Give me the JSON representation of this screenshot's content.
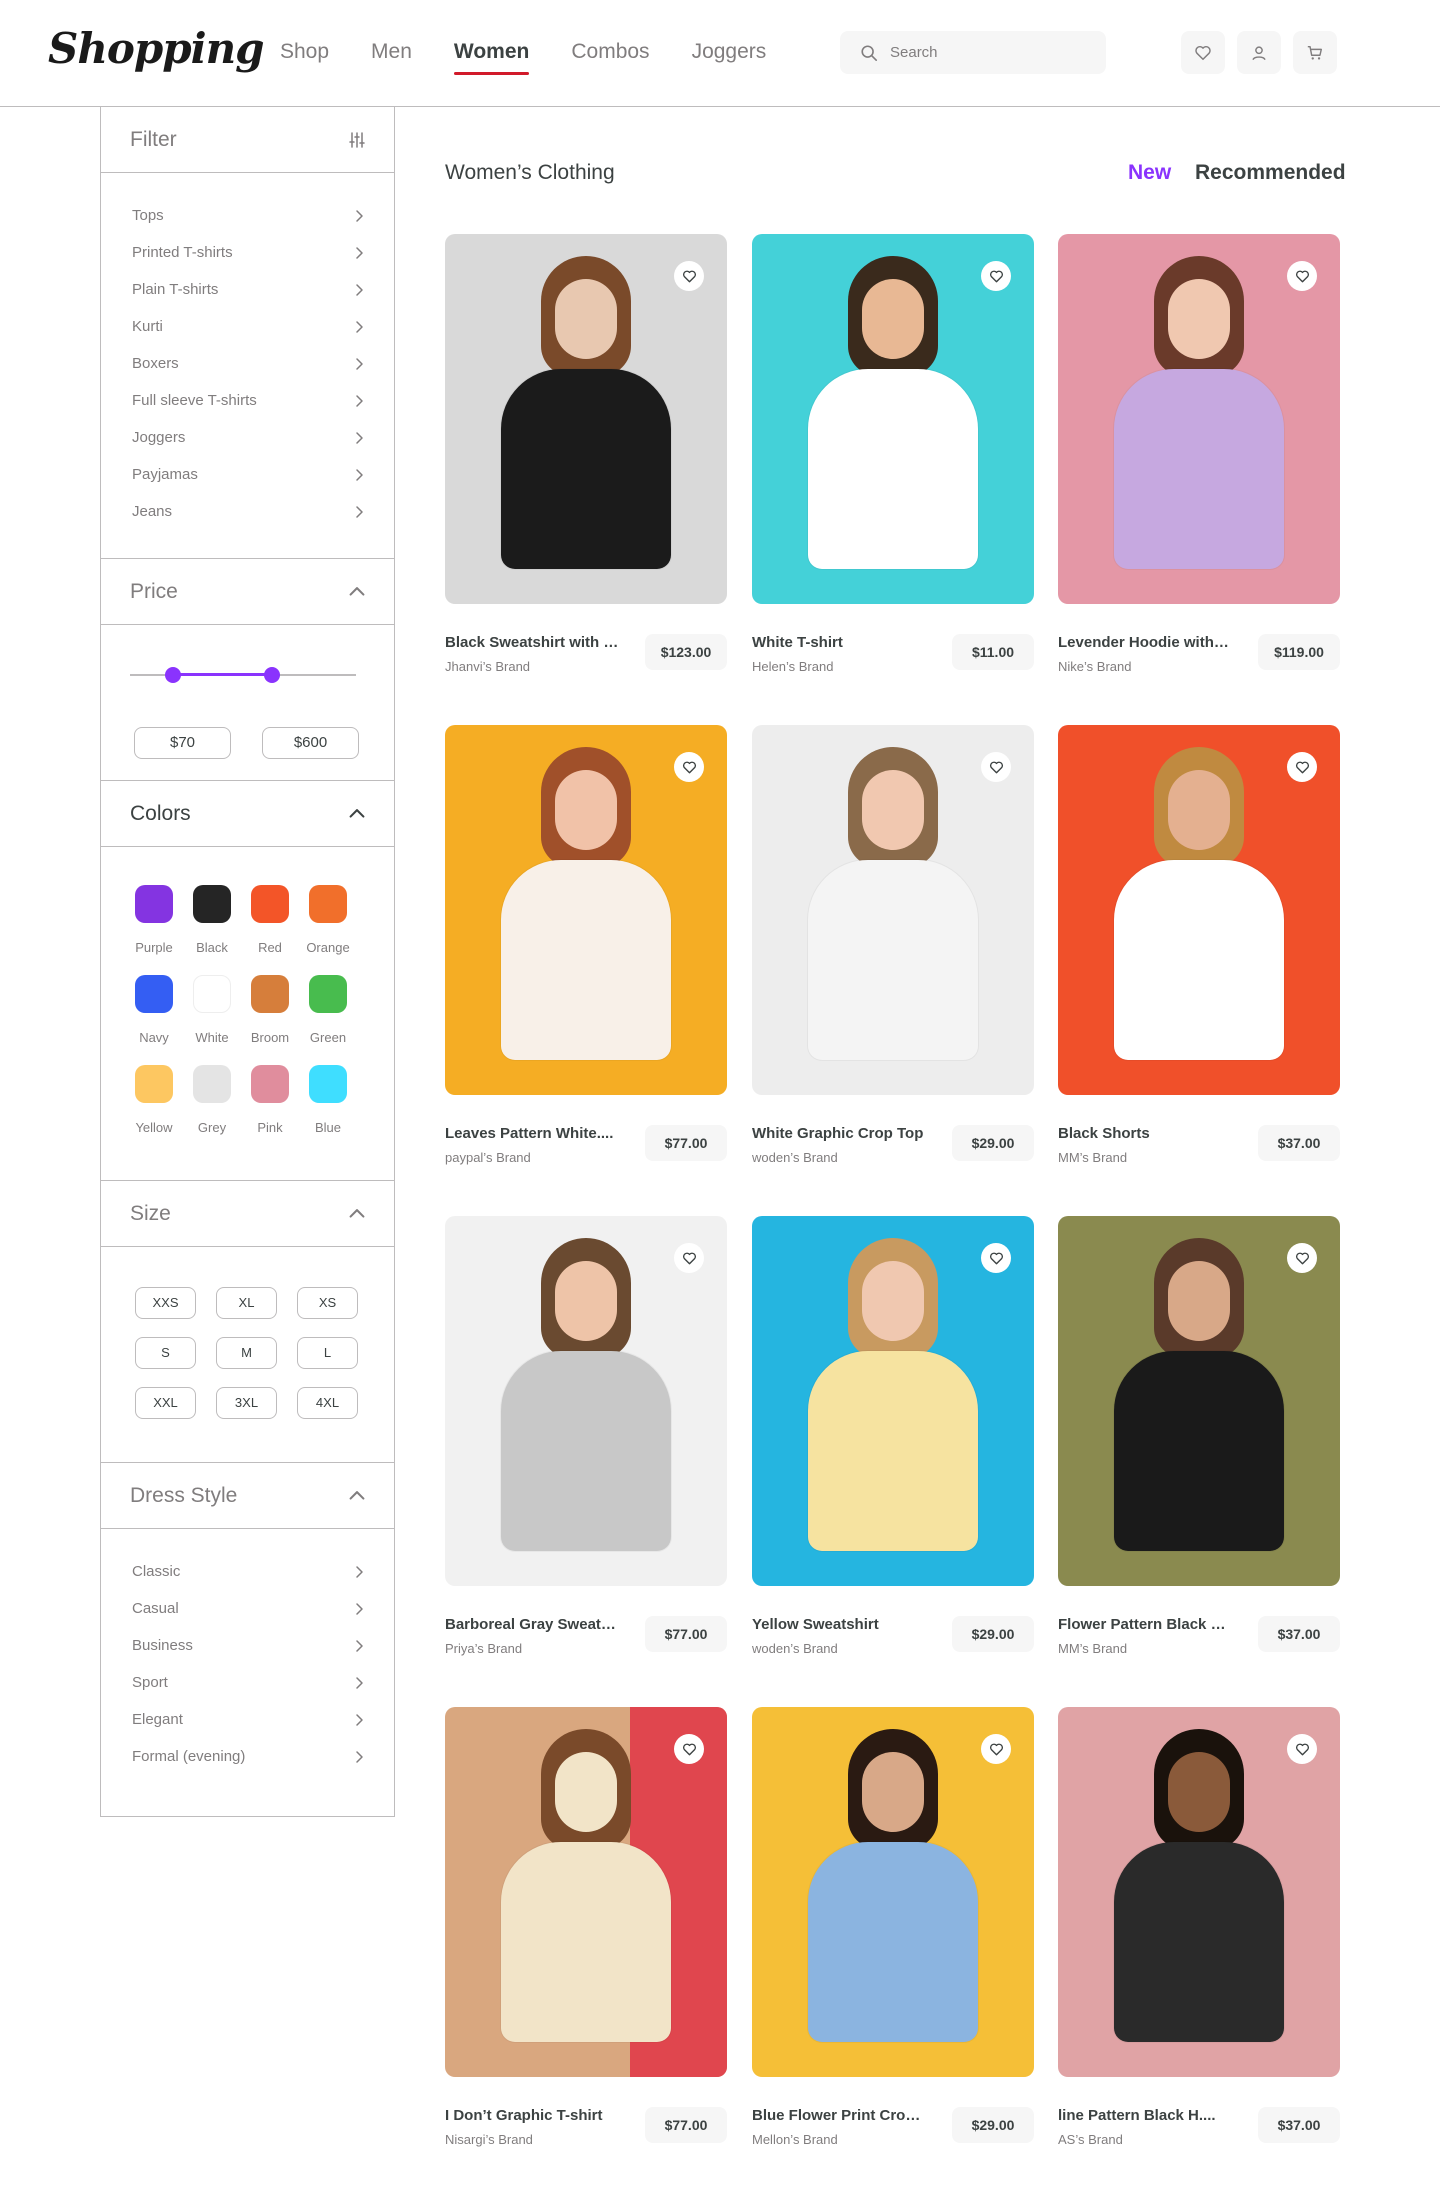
{
  "header": {
    "logo": "Shopping",
    "nav": [
      "Shop",
      "Men",
      "Women",
      "Combos",
      "Joggers"
    ],
    "active_nav": "Women",
    "search_placeholder": "Search",
    "icons": [
      "heart-icon",
      "user-icon",
      "cart-icon"
    ]
  },
  "filter": {
    "title": "Filter",
    "categories": [
      "Tops",
      "Printed T-shirts",
      "Plain T-shirts",
      "Kurti",
      "Boxers",
      "Full sleeve T-shirts",
      "Joggers",
      "Payjamas",
      "Jeans"
    ]
  },
  "price": {
    "title": "Price",
    "min_label": "$70",
    "max_label": "$600",
    "range_low_fraction": 0.19,
    "range_high_fraction": 0.63
  },
  "colors": {
    "title": "Colors",
    "items": [
      {
        "name": "Purple",
        "hex": "#8434e1"
      },
      {
        "name": "Black",
        "hex": "#252525"
      },
      {
        "name": "Red",
        "hex": "#f35528"
      },
      {
        "name": "Orange",
        "hex": "#f16f2b"
      },
      {
        "name": "Navy",
        "hex": "#345ef3"
      },
      {
        "name": "White",
        "hex": "#ffffff"
      },
      {
        "name": "Broom",
        "hex": "#d67e3b"
      },
      {
        "name": "Green",
        "hex": "#48bc4e"
      },
      {
        "name": "Yellow",
        "hex": "#fdc761"
      },
      {
        "name": "Grey",
        "hex": "#e4e4e4"
      },
      {
        "name": "Pink",
        "hex": "#e08d9d"
      },
      {
        "name": "Blue",
        "hex": "#3fdeff"
      }
    ]
  },
  "size": {
    "title": "Size",
    "items": [
      "XXS",
      "XL",
      "XS",
      "S",
      "M",
      "L",
      "XXL",
      "3XL",
      "4XL"
    ]
  },
  "dress_style": {
    "title": "Dress Style",
    "items": [
      "Classic",
      "Casual",
      "Business",
      "Sport",
      "Elegant",
      "Formal (evening)"
    ]
  },
  "main": {
    "title": "Women’s Clothing",
    "sort_new": "New",
    "sort_recommended": "Recommended"
  },
  "products": [
    {
      "name": "Black Sweatshirt with ....",
      "brand": "Jhanvi’s  Brand",
      "price": "$123.00",
      "bg": "#d9d9d9"
    },
    {
      "name": "White T-shirt",
      "brand": "Helen’s  Brand",
      "price": "$11.00",
      "bg": "#44d1d8"
    },
    {
      "name": "Levender Hoodie with ....",
      "brand": "Nike’s  Brand",
      "price": "$119.00",
      "bg": "#e497a6"
    },
    {
      "name": "Leaves Pattern White....",
      "brand": "paypal’s  Brand",
      "price": "$77.00",
      "bg": "#f5ad24"
    },
    {
      "name": "White Graphic Crop Top",
      "brand": "woden’s  Brand",
      "price": "$29.00",
      "bg": "#ededed"
    },
    {
      "name": "Black Shorts",
      "brand": "MM’s  Brand",
      "price": "$37.00",
      "bg": "#f0502a"
    },
    {
      "name": "Barboreal Gray Sweats....",
      "brand": "Priya’s  Brand",
      "price": "$77.00",
      "bg": "#f1f1f1"
    },
    {
      "name": "Yellow Sweatshirt",
      "brand": "woden’s  Brand",
      "price": "$29.00",
      "bg": "#25b5e0"
    },
    {
      "name": "Flower Pattern Black C....",
      "brand": "MM’s  Brand",
      "price": "$37.00",
      "bg": "#8a8a4f"
    },
    {
      "name": "I Don’t Graphic T-shirt",
      "brand": "Nisargi’s  Brand",
      "price": "$77.00",
      "bg": "#d9a77f"
    },
    {
      "name": "Blue Flower Print Crop ....",
      "brand": "Mellon’s  Brand",
      "price": "$29.00",
      "bg": "#f5bf37"
    },
    {
      "name": "line Pattern Black H....",
      "brand": "AS’s  Brand",
      "price": "$37.00",
      "bg": "#e0a3a5"
    }
  ]
}
